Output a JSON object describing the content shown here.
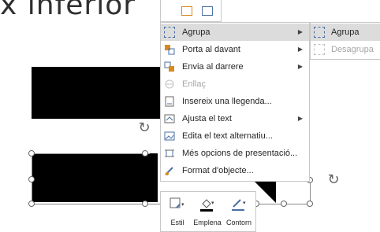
{
  "slide": {
    "title_fragment": "x inferior"
  },
  "context_menu": {
    "items": [
      {
        "label": "Agrupa",
        "icon": "group-icon",
        "submenu": true,
        "highlighted": true,
        "disabled": false
      },
      {
        "label": "Porta al davant",
        "icon": "bring-to-front-icon",
        "submenu": true,
        "highlighted": false,
        "disabled": false
      },
      {
        "label": "Envia al darrere",
        "icon": "send-to-back-icon",
        "submenu": true,
        "highlighted": false,
        "disabled": false
      },
      {
        "label": "Enllaç",
        "icon": "link-icon",
        "submenu": false,
        "highlighted": false,
        "disabled": true
      },
      {
        "label": "Insereix una llegenda...",
        "icon": "caption-icon",
        "submenu": false,
        "highlighted": false,
        "disabled": false
      },
      {
        "label": "Ajusta el text",
        "icon": "wrap-text-icon",
        "submenu": true,
        "highlighted": false,
        "disabled": false
      },
      {
        "label": "Edita el text alternatiu...",
        "icon": "alt-text-icon",
        "submenu": false,
        "highlighted": false,
        "disabled": false
      },
      {
        "label": "Més opcions de presentació...",
        "icon": "layout-options-icon",
        "submenu": false,
        "highlighted": false,
        "disabled": false
      },
      {
        "label": "Format d'objecte...",
        "icon": "format-object-icon",
        "submenu": false,
        "highlighted": false,
        "disabled": false
      }
    ]
  },
  "submenu": {
    "items": [
      {
        "label": "Agrupa",
        "icon": "group-icon",
        "highlighted": true,
        "disabled": false
      },
      {
        "label": "Desagrupa",
        "icon": "ungroup-icon",
        "highlighted": false,
        "disabled": true
      }
    ]
  },
  "mini_toolbar": {
    "buttons": [
      {
        "label": "Estil",
        "icon": "style-icon"
      },
      {
        "label": "Emplena",
        "icon": "fill-bucket-icon"
      },
      {
        "label": "Contorn",
        "icon": "outline-pen-icon"
      }
    ]
  },
  "colors": {
    "highlight": "#dcdcdc",
    "disabled_text": "#a6a6a6",
    "icon_blue": "#4a6fa5",
    "icon_orange": "#d88a1f"
  }
}
